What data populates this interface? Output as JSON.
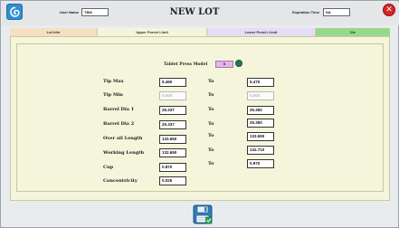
{
  "window": {
    "title": "NEW LOT",
    "close_glyph": "✕",
    "app_icon": "app-logo-icon"
  },
  "header": {
    "user_name_label": "User Name",
    "user_name_value": "TBM",
    "expiration_label": "Expiration Time",
    "expiration_value": "NA"
  },
  "tabs": [
    {
      "label": "Lot Info",
      "color": "#f7dfc2"
    },
    {
      "label": "Upper Punch Limit",
      "color": "#f4f5db"
    },
    {
      "label": "Lower Punch Limit",
      "color": "#e6dcf4"
    },
    {
      "label": "Die",
      "color": "#96d98d"
    }
  ],
  "press_model": {
    "label": "Tablet Press Model",
    "value": "8",
    "icon": "refresh-icon"
  },
  "to_label": "To",
  "rows": [
    {
      "label": "Tip Max",
      "from": "5.460",
      "to": "5.470",
      "disabled": false
    },
    {
      "label": "Tip Min",
      "from": "0.000",
      "to": "0.000",
      "disabled": true
    },
    {
      "label": "Barrel Dia 1",
      "from": "25.337",
      "to": "25.350",
      "disabled": false
    },
    {
      "label": "Barrel Dia 2",
      "from": "25.337",
      "to": "25.350",
      "disabled": false
    },
    {
      "label": "Over all Length",
      "from": "133.650",
      "to": "133.650",
      "disabled": false
    },
    {
      "label": "Working Length",
      "from": "132.650",
      "to": "132.710",
      "disabled": false
    },
    {
      "label": "Cup",
      "from": "0.870",
      "to": "0.970",
      "disabled": false
    },
    {
      "label": "Concentricity",
      "from": "0.025",
      "to": null,
      "disabled": false
    }
  ],
  "footer": {
    "save_icon": "save-icon"
  },
  "colors": {
    "accent_close": "#d92323",
    "panel_bg": "#f4f5db",
    "press_model_field": "#e7b3ee"
  }
}
